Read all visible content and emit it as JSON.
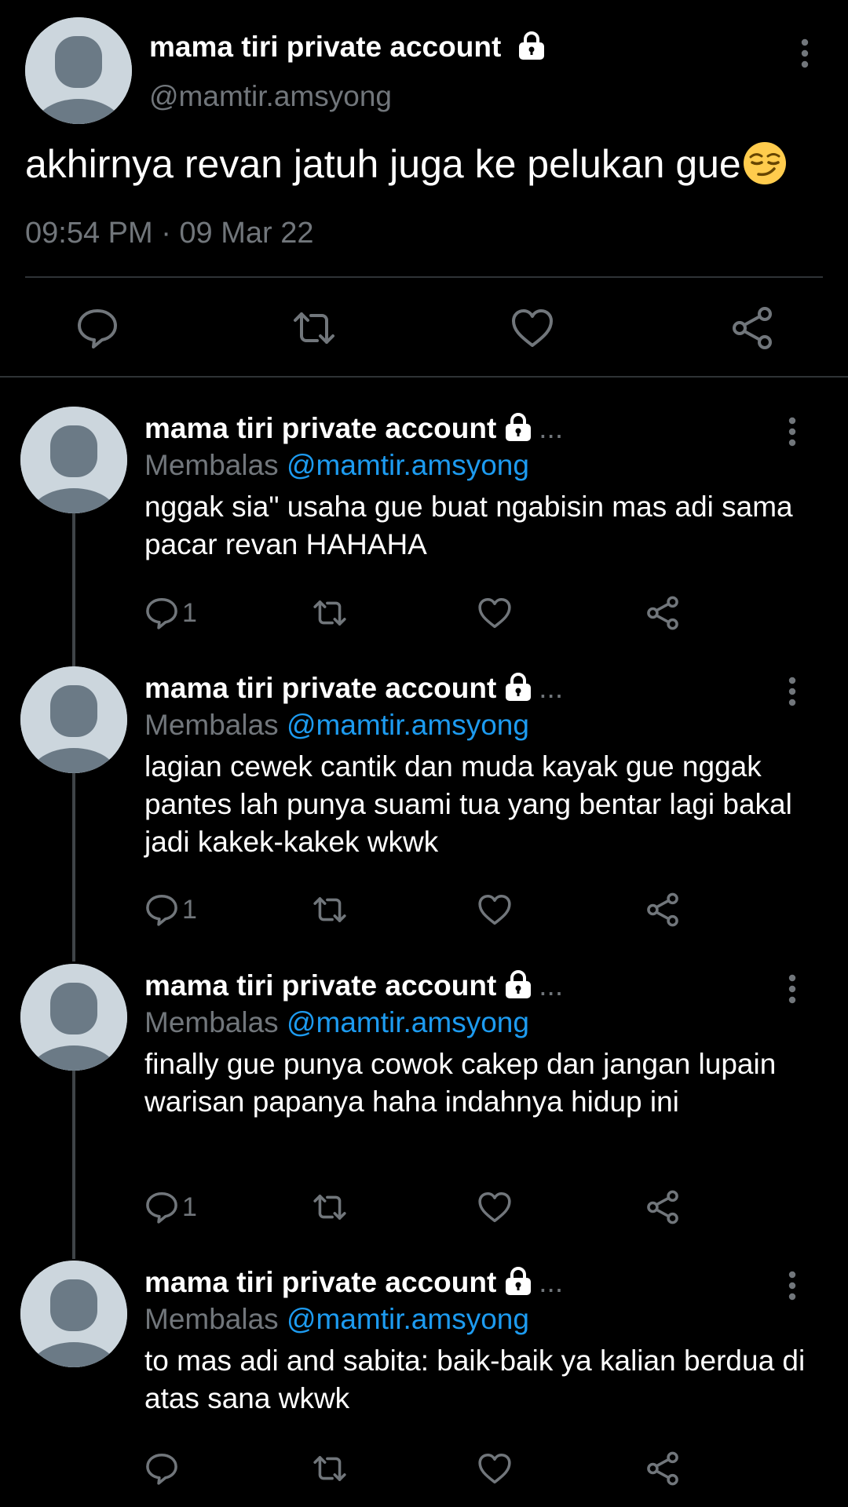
{
  "colors": {
    "background": "#000000",
    "text": "#ffffff",
    "muted": "#71767b",
    "link": "#1d9bf0",
    "divider": "#2f3336",
    "avatar_bg": "#ccd6dd",
    "avatar_fg": "#6b7a86"
  },
  "main_tweet": {
    "name": "mama tiri private account",
    "handle": "@mamtir.amsyong",
    "text": "akhirnya revan jatuh juga ke pelukan gue",
    "emoji": "smirking-face-emoji",
    "timestamp": "09:54 PM · 09 Mar 22",
    "actions": [
      "reply-icon",
      "retweet-icon",
      "like-icon",
      "share-icon"
    ]
  },
  "replies": [
    {
      "name": "mama tiri private account",
      "ellipsis": "...",
      "replying_label": "Membalas",
      "replying_to": "@mamtir.amsyong",
      "text": "nggak sia\" usaha gue buat ngabisin mas adi sama pacar revan HAHAHA",
      "reply_count": "1"
    },
    {
      "name": "mama tiri private account",
      "ellipsis": "...",
      "replying_label": "Membalas",
      "replying_to": "@mamtir.amsyong",
      "text": "lagian cewek cantik dan muda kayak gue nggak pantes lah punya suami tua yang bentar lagi bakal jadi kakek-kakek wkwk",
      "reply_count": "1"
    },
    {
      "name": "mama tiri private account",
      "ellipsis": "...",
      "replying_label": "Membalas",
      "replying_to": "@mamtir.amsyong",
      "text": "finally gue punya cowok cakep dan jangan lupain warisan papanya haha indahnya hidup ini",
      "reply_count": "1"
    },
    {
      "name": "mama tiri private account",
      "ellipsis": "...",
      "replying_label": "Membalas",
      "replying_to": "@mamtir.amsyong",
      "text": "to mas adi and sabita: baik-baik ya kalian berdua di atas sana wkwk",
      "reply_count": ""
    }
  ]
}
